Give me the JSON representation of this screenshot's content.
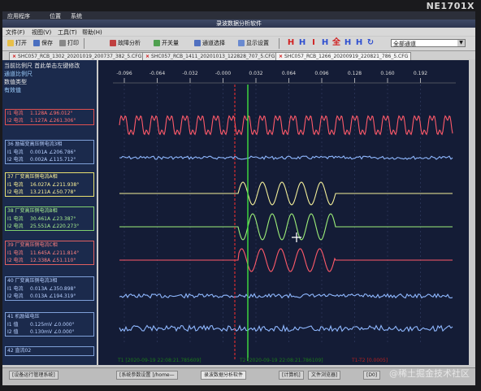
{
  "monitor": {
    "brand": "NE1701X"
  },
  "system_menu": {
    "apps": "应用程序",
    "places": "位置",
    "system": "系统"
  },
  "window": {
    "title": "录波数据分析软件"
  },
  "app_menu": {
    "file": "文件(F)",
    "view": "视图(V)",
    "tools": "工具(T)",
    "help": "帮助(H)"
  },
  "toolbar": {
    "open": "打开",
    "save": "保存",
    "print": "打印",
    "fault_analysis": "故障分析",
    "switch_value": "开关量",
    "channel_select": "通道选择",
    "display_settings": "显示设置",
    "channel_combo": "全部通道"
  },
  "tabs": [
    "SHC057_RCB_1302_20201019_200737_382_5.CFG",
    "SHC057_RCB_1411_20201013_122828_707_5.CFG",
    "SHC057_RCB_1266_20200919_220821_786_5.CFG"
  ],
  "left_panel": {
    "line1": "当前比例尺 首此单击左键修改",
    "line2": "通道比例尺",
    "line3": "数值类型",
    "line4": "有效值",
    "channels": [
      {
        "title": "",
        "rows": [
          {
            "label": "I1 电流",
            "value": "1.128A ∠96.012°"
          },
          {
            "label": "I2 电流",
            "value": "1.127A ∠261.306°"
          }
        ],
        "border": "#e05050",
        "color": "#ff7070"
      },
      {
        "title": "36 励磁变高压侧电流3相",
        "rows": [
          {
            "label": "I1 电流",
            "value": "0.001A ∠206.786°"
          },
          {
            "label": "I2 电流",
            "value": "0.002A ∠115.712°"
          }
        ],
        "border": "#7fa0d8",
        "color": "#b8d0ff"
      },
      {
        "title": "37 厂变高压侧电流A相",
        "rows": [
          {
            "label": "I1 电流",
            "value": "16.027A ∠211.938°"
          },
          {
            "label": "I2 电流",
            "value": "13.211A ∠50.778°"
          }
        ],
        "border": "#e8e070",
        "color": "#fff59a"
      },
      {
        "title": "38 厂变高压侧电流B相",
        "rows": [
          {
            "label": "I1 电流",
            "value": "30.461A ∠23.387°"
          },
          {
            "label": "I2 电流",
            "value": "25.551A ∠220.273°"
          }
        ],
        "border": "#80d070",
        "color": "#a8f090"
      },
      {
        "title": "39 厂变高压侧电流C相",
        "rows": [
          {
            "label": "I1 电流",
            "value": "11.645A ∠211.814°"
          },
          {
            "label": "I2 电流",
            "value": "12.338A ∠51.110°"
          }
        ],
        "border": "#e06060",
        "color": "#ff8080"
      },
      {
        "title": "40 厂变高压侧电流3相",
        "rows": [
          {
            "label": "I1 电流",
            "value": "0.013A ∠350.898°"
          },
          {
            "label": "I2 电流",
            "value": "0.013A ∠194.319°"
          }
        ],
        "border": "#7fa0d8",
        "color": "#b8d0ff"
      },
      {
        "title": "41 机励磁电压",
        "rows": [
          {
            "label": "I1 值",
            "value": "0.125mV ∠0.000°"
          },
          {
            "label": "I2 值",
            "value": "0.130mV ∠0.000°"
          }
        ],
        "border": "#7fa0d8",
        "color": "#b8d0ff"
      },
      {
        "title": "42 直流02",
        "rows": [],
        "border": "#7fa0d8",
        "color": "#b8d0ff"
      }
    ]
  },
  "plot": {
    "ticks": [
      "-0.096",
      "-0.064",
      "-0.032",
      "-0.000",
      "0.032",
      "0.064",
      "0.096",
      "0.128",
      "0.160",
      "0.192"
    ],
    "cursor_t1": "T1 [2020-09-19 22:08:21.785609]",
    "cursor_t2": "T2 [2020-09-19 22:08:21.786109]",
    "cursor_delta": "T1-T2 [0.0005]"
  },
  "taskbar": {
    "items": [
      "[设备运行管理系统]",
      "[系统参数设置 ]/home—",
      "录波数据分析软件",
      "[计算机]",
      "文件浏览器]",
      "[D0]"
    ],
    "watermark": "@稀土掘金技术社区"
  },
  "colors": {
    "red": "#ff5a6a",
    "yellow": "#f3ef9a",
    "green": "#9ef07a",
    "blue": "#8fb8ff",
    "cursor_red": "#ff3030",
    "cursor_green": "#40e040"
  }
}
